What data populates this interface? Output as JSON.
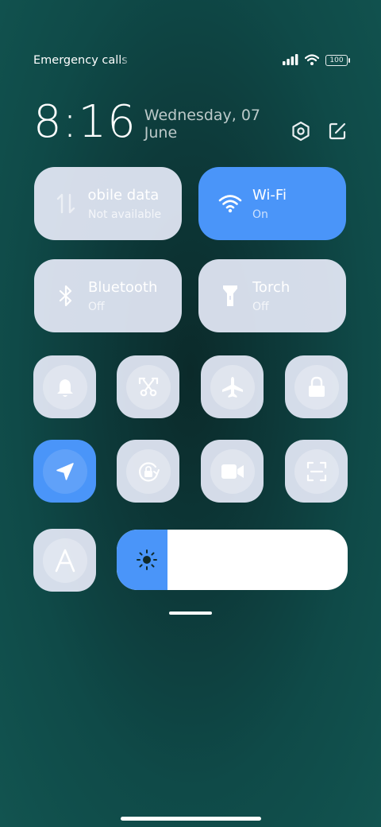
{
  "status_bar": {
    "carrier_text": "Emergency calls only",
    "battery": "100",
    "icons": [
      "signal-icon",
      "wifi-icon",
      "battery-icon"
    ]
  },
  "header": {
    "time": "8:16",
    "date": "Wednesday, 07 June",
    "actions": [
      "settings-icon",
      "edit-icon"
    ]
  },
  "big_tiles": [
    {
      "name": "mobile-data",
      "title": "Mobile data",
      "status": "Not available",
      "active": false,
      "icon": "data-arrows-icon"
    },
    {
      "name": "wifi",
      "title": "Wi-Fi",
      "status": "On",
      "active": true,
      "icon": "wifi-icon"
    },
    {
      "name": "bluetooth",
      "title": "Bluetooth",
      "status": "Off",
      "active": false,
      "icon": "bluetooth-icon"
    },
    {
      "name": "torch",
      "title": "Torch",
      "status": "Off",
      "active": false,
      "icon": "torch-icon"
    }
  ],
  "small_tiles": [
    {
      "name": "sound",
      "icon": "bell-icon",
      "active": false
    },
    {
      "name": "screenshot",
      "icon": "scissors-icon",
      "active": false
    },
    {
      "name": "airplane-mode",
      "icon": "airplane-icon",
      "active": false
    },
    {
      "name": "lock-screen",
      "icon": "lock-icon",
      "active": false
    },
    {
      "name": "location",
      "icon": "location-arrow-icon",
      "active": true
    },
    {
      "name": "rotation-lock",
      "icon": "rotation-lock-icon",
      "active": false
    },
    {
      "name": "screen-recorder",
      "icon": "video-camera-icon",
      "active": false
    },
    {
      "name": "scanner",
      "icon": "scan-icon",
      "active": false
    },
    {
      "name": "auto-brightness",
      "icon": "letter-a-icon",
      "active": false
    }
  ],
  "brightness": {
    "level": 0.22,
    "icon": "sun-icon"
  },
  "colors": {
    "accent": "#4a95f9",
    "tile": "#e4e8f6",
    "background": "#0d3a3a"
  }
}
